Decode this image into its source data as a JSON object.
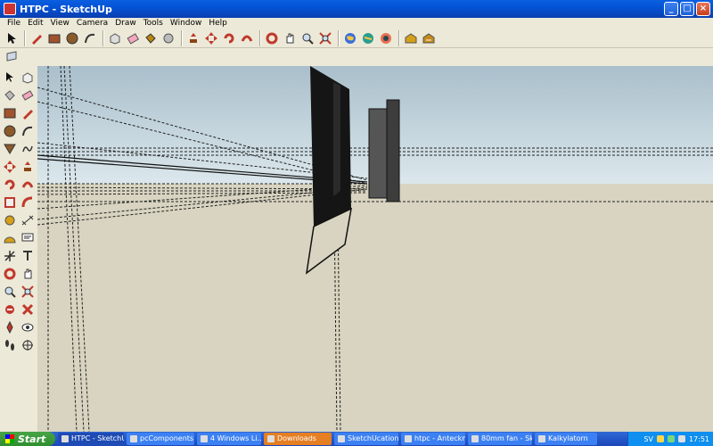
{
  "window": {
    "title": "HTPC - SketchUp"
  },
  "menu": [
    "File",
    "Edit",
    "View",
    "Camera",
    "Draw",
    "Tools",
    "Window",
    "Help"
  ],
  "toolbar": {
    "icons": [
      "select-icon",
      "pencil-icon",
      "rectangle-icon",
      "circle-icon",
      "arc-icon",
      "make-component-icon",
      "eraser-icon",
      "paint-bucket-icon",
      "push-pull-icon",
      "move-icon",
      "rotate-icon",
      "follow-me-icon",
      "offset-icon",
      "orbit-icon",
      "pan-icon",
      "zoom-icon",
      "zoom-extents-icon",
      "google-earth-icon",
      "get-models-icon",
      "share-model-icon",
      "warehouse-icon",
      "layers-icon"
    ]
  },
  "taskbar": {
    "start_label": "Start",
    "tasks": [
      {
        "label": "HTPC - SketchUp",
        "state": "active"
      },
      {
        "label": "pcComponents...",
        "state": "normal"
      },
      {
        "label": "4 Windows Li...",
        "state": "normal"
      },
      {
        "label": "Downloads",
        "state": "orange"
      },
      {
        "label": "SketchUcation ...",
        "state": "normal"
      },
      {
        "label": "htpc - Anteckn...",
        "state": "normal"
      },
      {
        "label": "80mm fan - Sk...",
        "state": "normal"
      },
      {
        "label": "Kalkylatorn",
        "state": "normal"
      }
    ],
    "language": "SV",
    "clock": "17:51"
  },
  "colors": {
    "sky": "#dbe7ec",
    "ground": "#d8d4c1",
    "accent": "#0A5FE0"
  }
}
